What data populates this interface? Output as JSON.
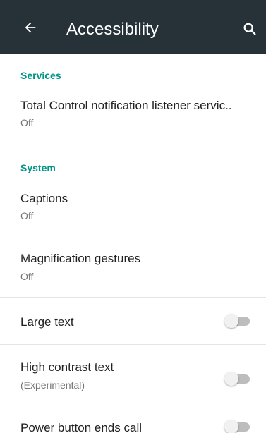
{
  "header": {
    "title": "Accessibility",
    "back_icon": "arrow-back-icon",
    "search_icon": "search-icon",
    "background": "#263238"
  },
  "sections": {
    "services": "Services",
    "system": "System",
    "accent": "#009688"
  },
  "items": [
    {
      "title": "Total Control notification listener servic..",
      "subtitle": "Off"
    },
    {
      "title": "Captions",
      "subtitle": "Off"
    },
    {
      "title": "Magnification gestures",
      "subtitle": "Off"
    },
    {
      "title": "Large text",
      "toggle": false
    },
    {
      "title": "High contrast text",
      "subtitle": "(Experimental)",
      "toggle": false
    },
    {
      "title": "Power button ends call",
      "toggle": false
    }
  ]
}
